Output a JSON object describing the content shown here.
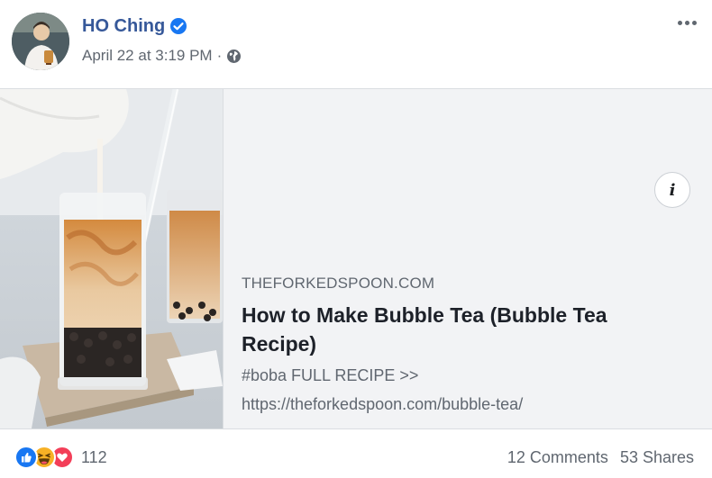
{
  "post": {
    "author": "HO Ching",
    "timestamp": "April 22 at 3:19 PM",
    "separator": "·",
    "privacy_icon": "globe-icon",
    "verified_icon": "verified-badge-icon",
    "more_icon": "more-options-icon"
  },
  "link_card": {
    "domain": "THEFORKEDSPOON.COM",
    "title": "How to Make Bubble Tea (Bubble Tea Recipe)",
    "description_line1": "#boba FULL RECIPE >>",
    "description_line2": "https://theforkedspoon.com/bubble-tea/",
    "info_label": "i"
  },
  "footer": {
    "reaction_icons": [
      "like-icon",
      "haha-icon",
      "love-icon"
    ],
    "reaction_count": "112",
    "comments": "12 Comments",
    "shares": "53 Shares"
  },
  "colors": {
    "author": "#365899",
    "verified": "#1877f2",
    "secondary_text": "#606770",
    "card_background": "#f2f3f5",
    "like": "#1877f2",
    "haha": "#f7b125",
    "love": "#f33e58"
  }
}
